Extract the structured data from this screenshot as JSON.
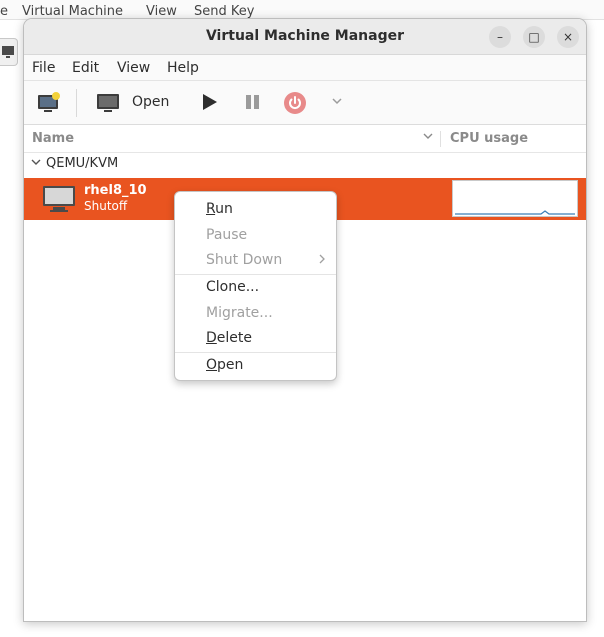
{
  "background_app": {
    "menu_items": [
      "e",
      "Virtual Machine",
      "View",
      "Send Key"
    ]
  },
  "window": {
    "title": "Virtual Machine Manager",
    "controls": {
      "minimize": "–",
      "maximize": "□",
      "close": "×"
    }
  },
  "menubar": {
    "file": "File",
    "edit": "Edit",
    "view": "View",
    "help": "Help"
  },
  "toolbar": {
    "open_label": "Open"
  },
  "columns": {
    "name": "Name",
    "cpu": "CPU usage"
  },
  "group": {
    "label": "QEMU/KVM"
  },
  "vm": {
    "name": "rhel8_10",
    "status": "Shutoff"
  },
  "context_menu": {
    "items": [
      {
        "pre": "",
        "mnemonic": "R",
        "post": "un"
      },
      {
        "pre": "Pause",
        "mnemonic": "",
        "post": ""
      },
      {
        "pre": "Shut Down",
        "mnemonic": "",
        "post": ""
      },
      {
        "pre": "Clone...",
        "mnemonic": "",
        "post": ""
      },
      {
        "pre": "Migrate...",
        "mnemonic": "",
        "post": ""
      },
      {
        "pre": "",
        "mnemonic": "D",
        "post": "elete"
      },
      {
        "pre": "",
        "mnemonic": "O",
        "post": "pen"
      }
    ]
  },
  "colors": {
    "accent": "#e95420",
    "graph_line": "#3a7fb8"
  }
}
